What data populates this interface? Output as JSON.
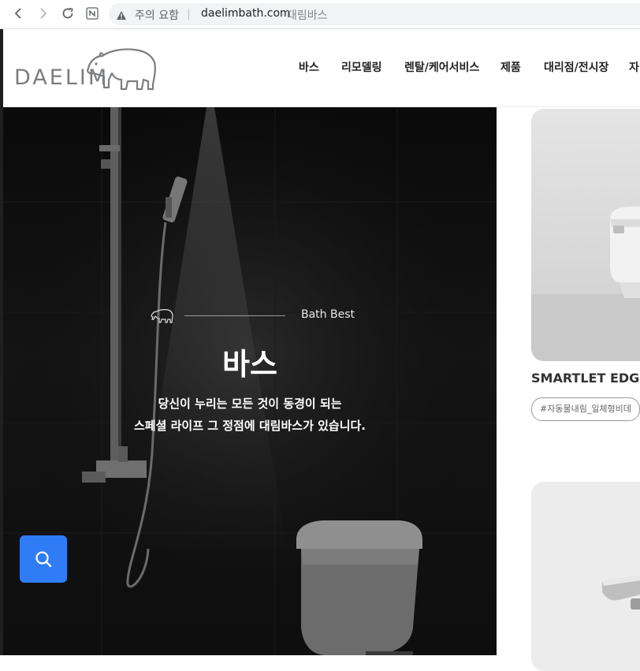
{
  "browser": {
    "security_label": "주의 요함",
    "url": "daelimbath.com",
    "page_title": "대림바스"
  },
  "site": {
    "logo_text": "DAELIM",
    "nav": [
      "바스",
      "리모델링",
      "렌탈/케어서비스",
      "제품",
      "대리점/전시장",
      "자"
    ]
  },
  "hero": {
    "kicker": "Bath Best",
    "title": "바스",
    "desc_line1": "당신이 누리는 모든 것이 동경이 되는",
    "desc_line2": "스페셜 라이프 그 정점에 대림바스가 있습니다."
  },
  "products": [
    {
      "name": "SMARTLET EDGE",
      "tag": "#자동물내림_일체형비데"
    }
  ],
  "colors": {
    "accent": "#2f7cf6",
    "hero_bg": "#0e0e0e"
  }
}
